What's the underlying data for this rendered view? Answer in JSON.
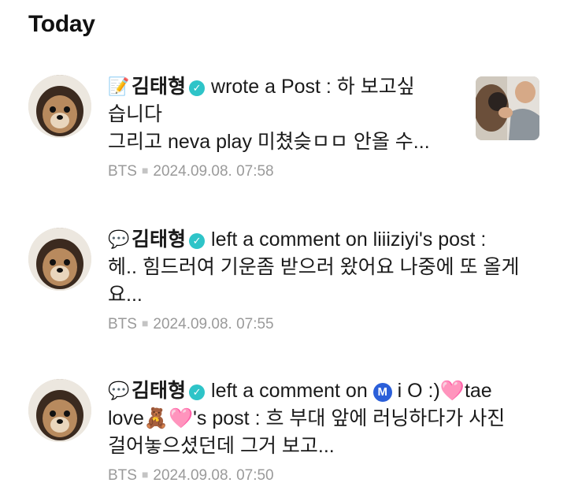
{
  "section": {
    "title": "Today"
  },
  "notifications": [
    {
      "type_icon": "memo-icon",
      "type_glyph": "📝",
      "user_name": "김태형",
      "action": "wrote a Post : 하 보고싶",
      "line2": "습니다",
      "line3": "그리고 neva play 미쳤슺ㅁㅁ 안올 수...",
      "group": "BTS",
      "timestamp": "2024.09.08. 07:58",
      "has_thumbnail": true
    },
    {
      "type_icon": "speech-bubble-icon",
      "type_glyph": "💬",
      "user_name": "김태형",
      "action": "left a comment on liiiziyi's post :",
      "line2": "헤.. 힘드러여 기운좀 받으러 왔어요 나중에 또 올게",
      "line3": "요...",
      "group": "BTS",
      "timestamp": "2024.09.08. 07:55"
    },
    {
      "type_icon": "speech-bubble-icon",
      "type_glyph": "💬",
      "user_name": "김태형",
      "action_prefix": "left a comment on",
      "badge_letter": "M",
      "action_mid": "i O :)",
      "heart_glyph": "🩷",
      "action_tail": "tae",
      "line2_start": "love",
      "bear_glyph": "🧸",
      "line2_end": "'s post : 흐 부대 앞에 러닝하다가 사진",
      "line3": "걸어놓으셨던데 그거 보고...",
      "group": "BTS",
      "timestamp": "2024.09.08. 07:50"
    }
  ],
  "colors": {
    "verified": "#2ec4c8",
    "meta": "#9a9a9a",
    "badge": "#2b5fd9"
  }
}
